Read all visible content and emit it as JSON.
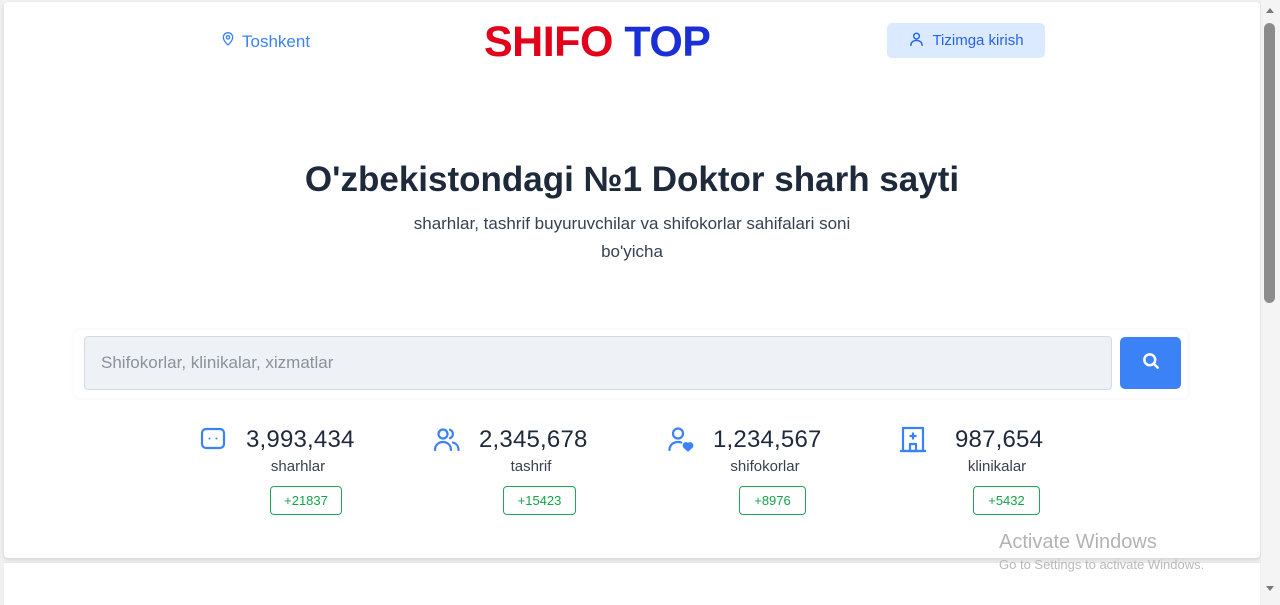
{
  "header": {
    "location": "Toshkent",
    "logo_red": "SHIFO",
    "logo_blue": "TOP",
    "login_label": "Tizimga kirish"
  },
  "hero": {
    "title": "O'zbekistondagi №1 Doktor sharh sayti",
    "subtitle": "sharhlar, tashrif buyuruvchilar va shifokorlar sahifalari soni bo'yicha"
  },
  "search": {
    "placeholder": "Shifokorlar, klinikalar, xizmatlar"
  },
  "stats": [
    {
      "icon": "chat-bubble-icon",
      "value": "3,993,434",
      "label": "sharhlar",
      "delta": "+21837"
    },
    {
      "icon": "users-icon",
      "value": "2,345,678",
      "label": "tashrif",
      "delta": "+15423"
    },
    {
      "icon": "user-heart-icon",
      "value": "1,234,567",
      "label": "shifokorlar",
      "delta": "+8976"
    },
    {
      "icon": "hospital-icon",
      "value": "987,654",
      "label": "klinikalar",
      "delta": "+5432"
    }
  ],
  "watermark": {
    "title": "Activate Windows",
    "subtitle": "Go to Settings to activate Windows."
  },
  "colors": {
    "accent": "#3b82f6",
    "logo_red": "#e3001b",
    "logo_blue": "#1a2fd6",
    "badge_green": "#16a34a"
  }
}
